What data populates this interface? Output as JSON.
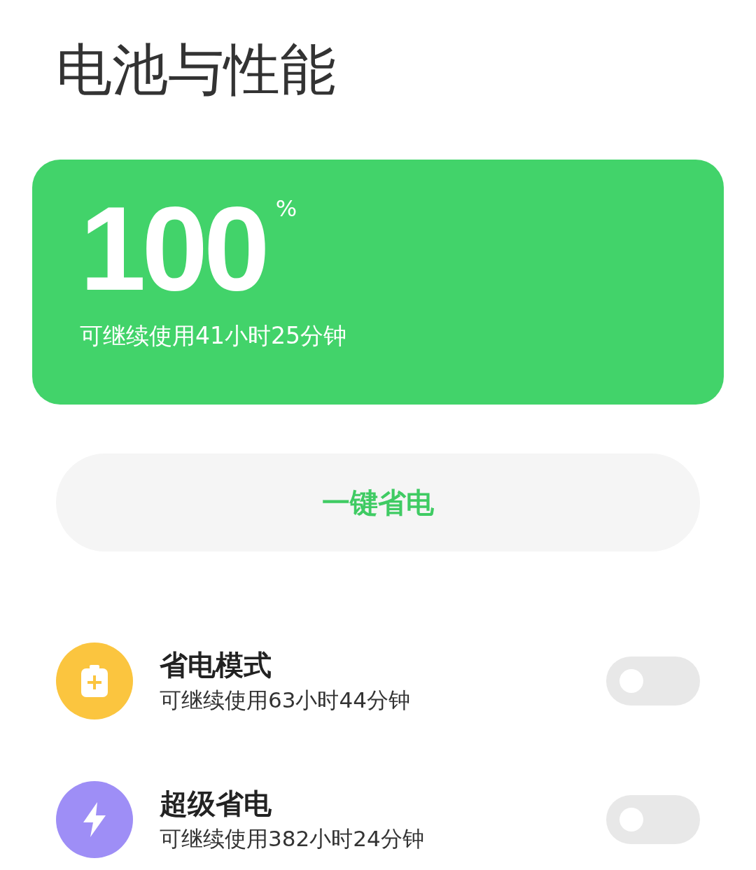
{
  "title": "电池与性能",
  "battery": {
    "percent": "100",
    "unit": "%",
    "remaining": "可继续使用41小时25分钟"
  },
  "action_button": {
    "label": "一键省电"
  },
  "modes": [
    {
      "kind": "battery",
      "title": "省电模式",
      "subtitle": "可继续使用63小时44分钟",
      "on": false,
      "color": "#fbc53f"
    },
    {
      "kind": "bolt",
      "title": "超级省电",
      "subtitle": "可继续使用382小时24分钟",
      "on": false,
      "color": "#9e8ef6"
    }
  ]
}
